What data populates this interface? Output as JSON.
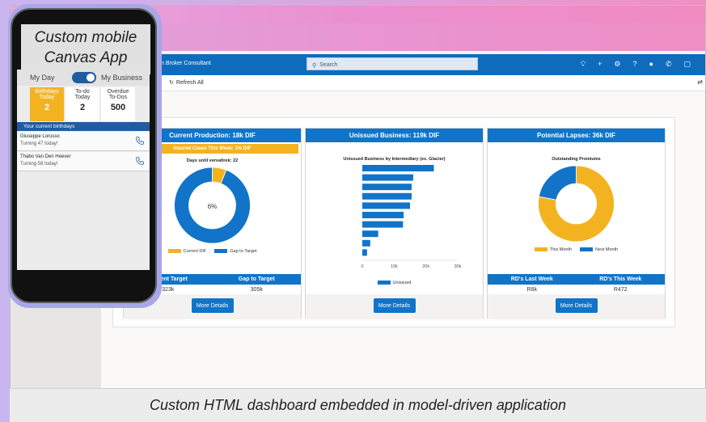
{
  "tags": {
    "mobile_line1": "Custom mobile",
    "mobile_line2": "Canvas App",
    "caption": "Custom HTML dashboard embedded in model-driven application"
  },
  "appbar": {
    "title": "n Broker Consultant",
    "search_placeholder": "Search",
    "icons": [
      "lightbulb-icon",
      "plus-icon",
      "gear-icon",
      "help-icon",
      "avatar-icon",
      "phone-icon",
      "chat-icon"
    ]
  },
  "cmdbar": {
    "refresh_label": "Refresh All"
  },
  "cards": [
    {
      "title": "Current Production: 18k DIF",
      "subtitle": "Insured Cases This Week: 1% DIF",
      "chart_title": "Days until vervaltrek: 22",
      "center_label": "6%",
      "legend": [
        "Current DIF",
        "Gap to Target"
      ],
      "stat_labels": [
        "Current Target",
        "Gap to Target"
      ],
      "stat_values": [
        "323k",
        "305k"
      ],
      "button": "More Details"
    },
    {
      "title": "Unissued Business: 119k DIF",
      "chart_title": "Unissued Business by Intermediary (ex. Glacier)",
      "legend": [
        "Unissued"
      ],
      "button": "More Details"
    },
    {
      "title": "Potential Lapses: 36k DIF",
      "chart_title": "Outstanding Premiums",
      "legend": [
        "This Month",
        "Next Month"
      ],
      "stat_labels": [
        "RD's Last Week",
        "RD's This Week"
      ],
      "stat_values": [
        "R8k",
        "R472"
      ],
      "button": "More Details"
    }
  ],
  "chart_data": [
    {
      "type": "pie",
      "title": "Days until vervaltrek: 22",
      "labels": [
        "Current DIF",
        "Gap to Target"
      ],
      "values": [
        6,
        94
      ],
      "colors": [
        "#f3b321",
        "#1174c8"
      ]
    },
    {
      "type": "bar",
      "title": "Unissued Business by Intermediary (ex. Glacier)",
      "orientation": "horizontal",
      "series": [
        {
          "name": "Unissued",
          "values": [
            22500,
            16000,
            15500,
            15500,
            15000,
            13000,
            12800,
            5000,
            2500,
            1500
          ]
        }
      ],
      "xlim": [
        0,
        30000
      ],
      "xticks": [
        "0",
        "10k",
        "20k",
        "30k"
      ],
      "color": "#1174c8"
    },
    {
      "type": "pie",
      "title": "Outstanding Premiums",
      "labels": [
        "This Month",
        "Next Month"
      ],
      "values": [
        78,
        22
      ],
      "colors": [
        "#f3b321",
        "#1174c8"
      ]
    }
  ],
  "mobile": {
    "toggle_left": "My Day",
    "toggle_right": "My Business",
    "tiles": [
      {
        "line1": "Birthdays",
        "line2": "Today",
        "value": "2"
      },
      {
        "line1": "To-do",
        "line2": "Today",
        "value": "2"
      },
      {
        "line1": "Overdue",
        "line2": "To-Dos",
        "value": "500"
      }
    ],
    "birthdays_header": "Your current birthdays",
    "people": [
      {
        "name": "Giuseppe Lorusso",
        "note": "Turning 47 today!"
      },
      {
        "name": "Thabo Van Den Heever",
        "note": "Turning 58 today!"
      }
    ]
  }
}
